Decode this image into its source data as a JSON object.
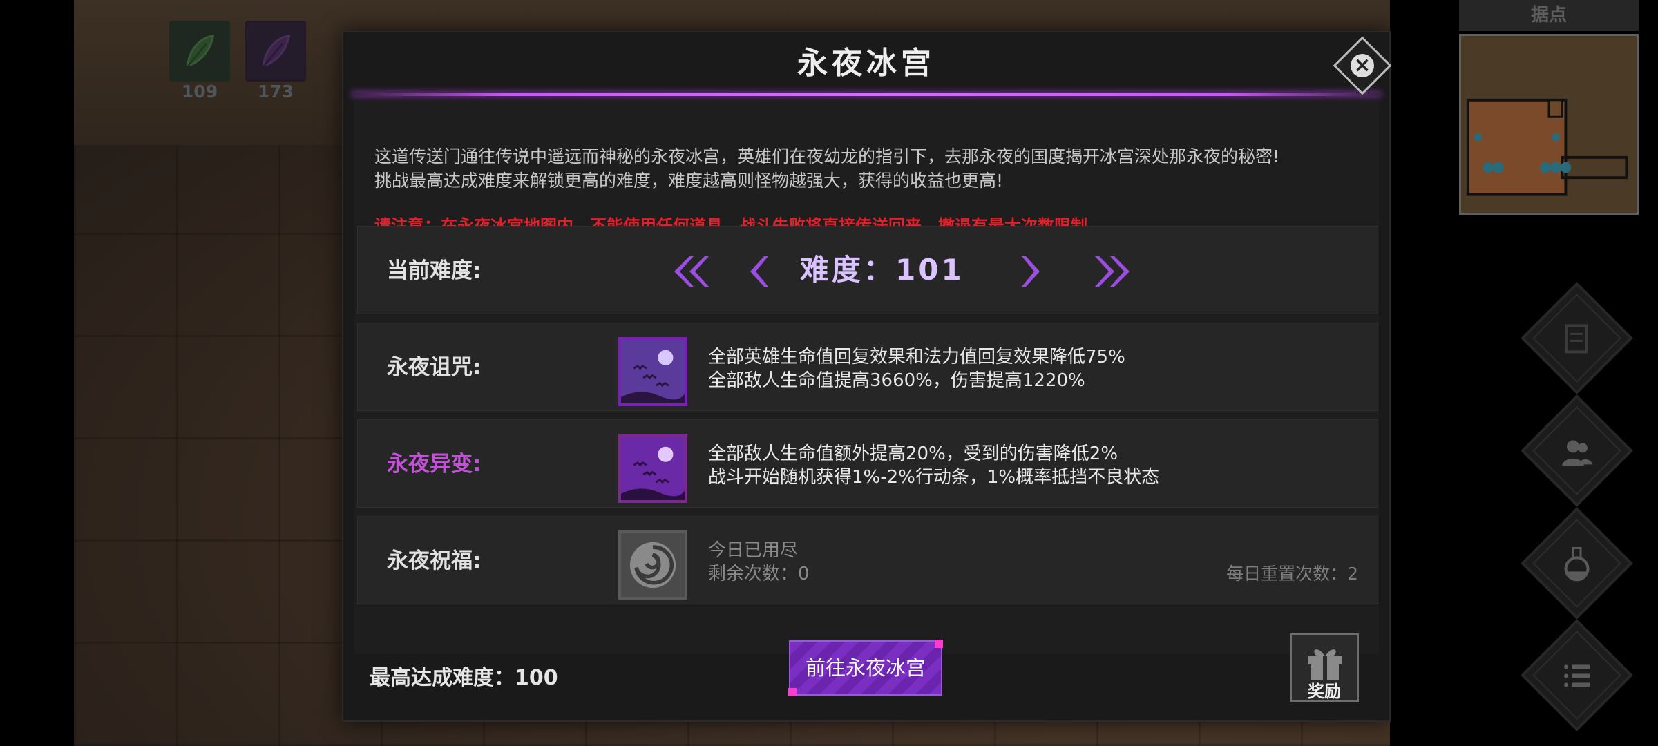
{
  "resources": [
    {
      "icon": "green-leaf-icon",
      "count": "109"
    },
    {
      "icon": "purple-leaf-icon",
      "count": "173"
    }
  ],
  "minimap": {
    "title": "据点"
  },
  "side_menu": [
    "scroll-icon",
    "party-icon",
    "potion-icon",
    "list-menu-icon"
  ],
  "panel": {
    "title": "永夜冰宫",
    "close_icon": "close-icon",
    "description_line1": "这道传送门通往传说中遥远而神秘的永夜冰宫，英雄们在夜幼龙的指引下，去那永夜的国度揭开冰宫深处那永夜的秘密!",
    "description_line2": "挑战最高达成难度来解锁更高的难度，难度越高则怪物越强大，获得的收益也更高!",
    "warning": "请注意：在永夜冰宫地图内，不能使用任何道具。战斗失败将直接传送回来，撤退有最大次数限制。"
  },
  "difficulty": {
    "label": "当前难度:",
    "value_text": "难度：101"
  },
  "curse": {
    "label": "永夜诅咒:",
    "line1": "全部英雄生命值回复效果和法力值回复效果降低75%",
    "line2": "全部敌人生命值提高3660%，伤害提高1220%"
  },
  "mutation": {
    "label": "永夜异变:",
    "line1": "全部敌人生命值额外提高20%，受到的伤害降低2%",
    "line2": "战斗开始随机获得1%-2%行动条，1%概率抵挡不良状态"
  },
  "blessing": {
    "label": "永夜祝福:",
    "line1": "今日已用尽",
    "line2": "剩余次数：0",
    "daily_reset": "每日重置次数：2"
  },
  "footer": {
    "highest": "最高达成难度：100",
    "go_button": "前往永夜冰宫",
    "reward_label": "奖励"
  },
  "colors": {
    "accent_purple": "#9b4fe0",
    "warning_red": "#e0202a",
    "mutation_magenta": "#c350d8"
  }
}
